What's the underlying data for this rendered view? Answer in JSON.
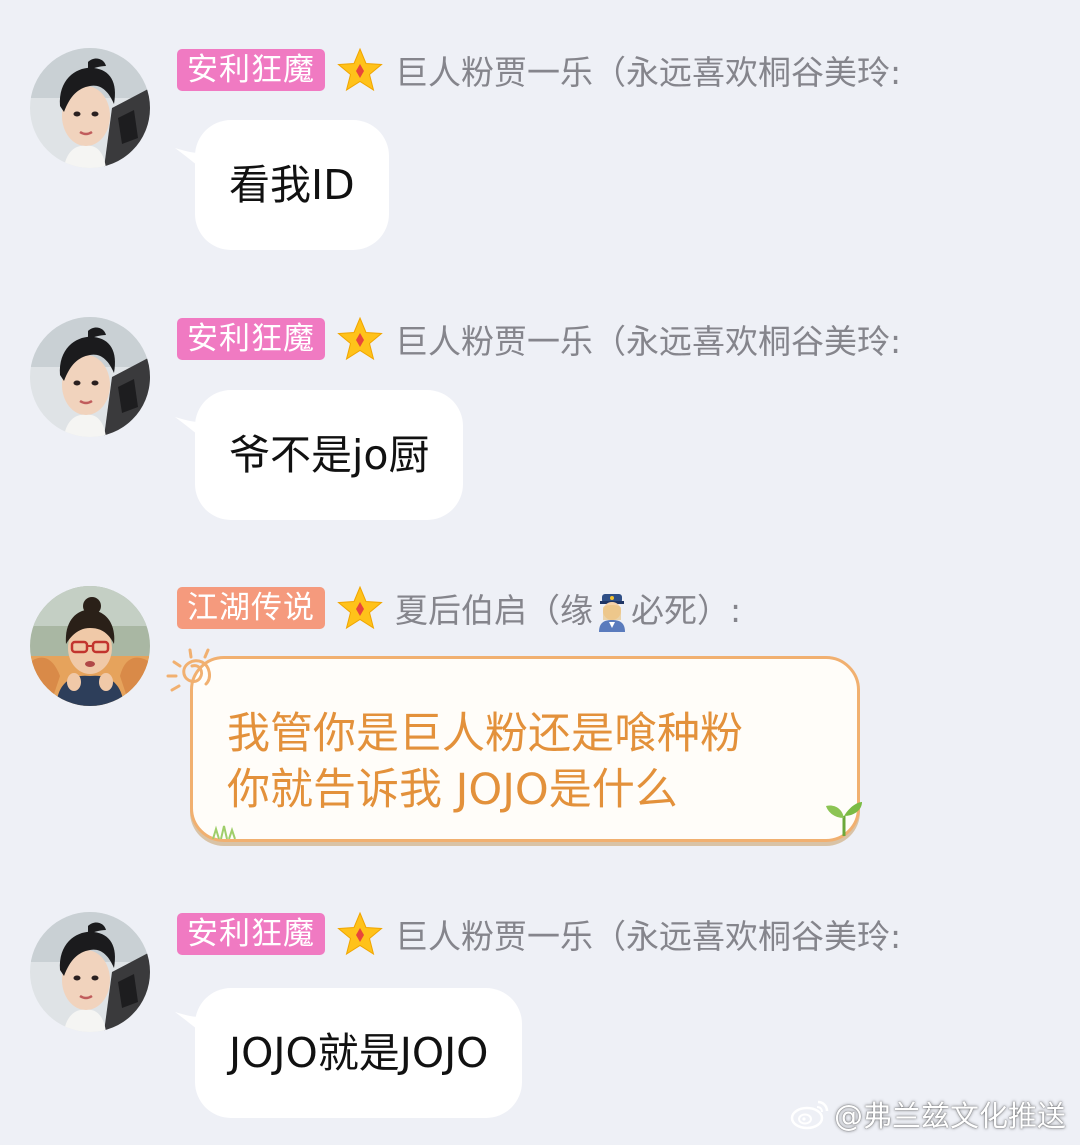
{
  "messages": [
    {
      "badge": "安利狂魔",
      "badge_color": "#f07ac2",
      "sender": "巨人粉贾一乐（永远喜欢桐谷美玲:",
      "text": "看我ID"
    },
    {
      "badge": "安利狂魔",
      "badge_color": "#f07ac2",
      "sender": "巨人粉贾一乐（永远喜欢桐谷美玲:",
      "text": "爷不是jo厨"
    },
    {
      "badge": "江湖传说",
      "badge_color": "#f59a7d",
      "sender_prefix": "夏后伯启（缘",
      "sender_emoji": "police-officer-emoji",
      "sender_suffix": "必死）:",
      "lines": [
        "我管你是巨人粉还是喰种粉",
        "你就告诉我 JOJO是什么"
      ]
    },
    {
      "badge": "安利狂魔",
      "badge_color": "#f07ac2",
      "sender": "巨人粉贾一乐（永远喜欢桐谷美玲:",
      "text": "JOJO就是JOJO"
    }
  ],
  "watermark": {
    "icon": "weibo-icon",
    "text": "@弗兰兹文化推送"
  },
  "colors": {
    "background": "#eef0f6",
    "bubble": "#ffffff",
    "fancy_text": "#e3913b",
    "sender_name": "#85858c"
  }
}
